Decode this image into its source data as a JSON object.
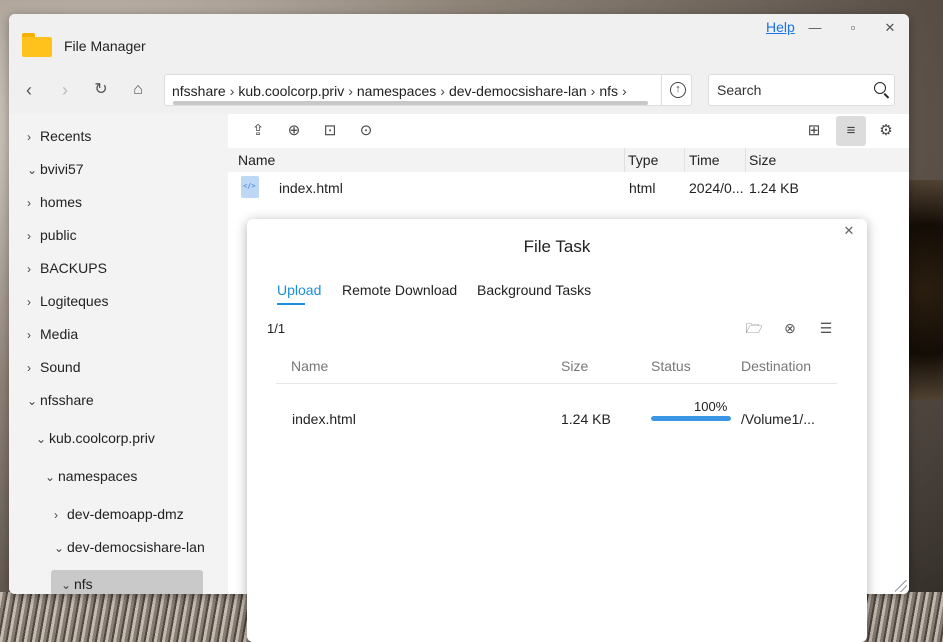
{
  "window": {
    "title": "File Manager",
    "help": "Help"
  },
  "nav": {
    "breadcrumb": [
      "nfsshare",
      "kub.coolcorp.priv",
      "namespaces",
      "dev-democsishare-lan",
      "nfs"
    ],
    "search_placeholder": "Search"
  },
  "sidebar": {
    "items": [
      {
        "label": "Recents",
        "chevron": "›"
      },
      {
        "label": "bvivi57",
        "chevron": "⌄"
      },
      {
        "label": "homes",
        "chevron": "›"
      },
      {
        "label": "public",
        "chevron": "›"
      },
      {
        "label": "BACKUPS",
        "chevron": "›"
      },
      {
        "label": "Logiteques",
        "chevron": "›"
      },
      {
        "label": "Media",
        "chevron": "›"
      },
      {
        "label": "Sound",
        "chevron": "›"
      },
      {
        "label": "nfsshare",
        "chevron": "⌄"
      },
      {
        "label": "kub.coolcorp.priv",
        "chevron": "⌄"
      },
      {
        "label": "namespaces",
        "chevron": "⌄"
      },
      {
        "label": "dev-demoapp-dmz",
        "chevron": "›"
      },
      {
        "label": "dev-democsishare-lan",
        "chevron": "⌄"
      },
      {
        "label": "nfs",
        "chevron": "⌄"
      }
    ]
  },
  "file_list": {
    "columns": [
      "Name",
      "Type",
      "Time",
      "Size"
    ],
    "rows": [
      {
        "name": "index.html",
        "type": "html",
        "time": "2024/0...",
        "size": "1.24 KB"
      }
    ]
  },
  "file_task": {
    "title": "File Task",
    "tabs": [
      "Upload",
      "Remote Download",
      "Background Tasks"
    ],
    "active_tab": "Upload",
    "count": "1/1",
    "columns": [
      "Name",
      "Size",
      "Status",
      "Destination"
    ],
    "rows": [
      {
        "name": "index.html",
        "size": "1.24 KB",
        "status": "100%",
        "progress": 1.0,
        "destination": "/Volume1/..."
      }
    ]
  },
  "colors": {
    "accent": "#1a8fd8",
    "progress": "#3b97e6",
    "folder": "#ffc21c"
  }
}
